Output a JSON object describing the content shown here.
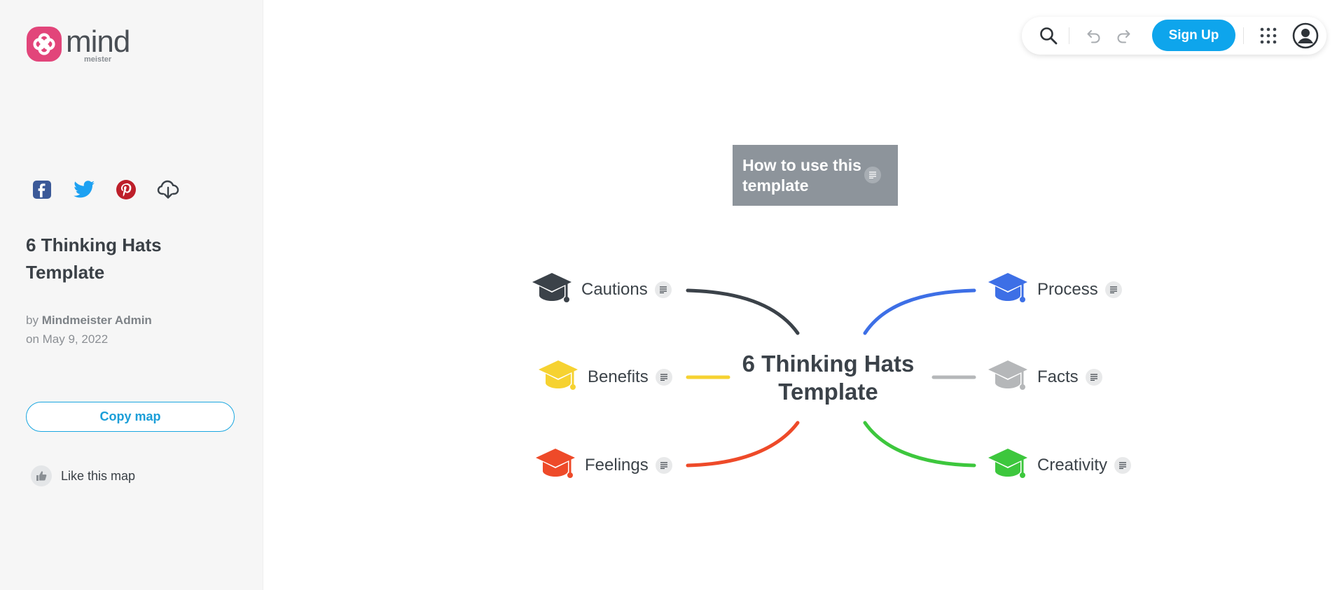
{
  "brand": {
    "name": "mind",
    "sub": "meister",
    "color": "#e2457a"
  },
  "share": {
    "icons": [
      "facebook-icon",
      "twitter-icon",
      "pinterest-icon",
      "cloud-download-icon"
    ]
  },
  "map_info": {
    "title": "6 Thinking Hats Template",
    "by_prefix": "by",
    "author": "Mindmeister Admin",
    "date": "on May 9, 2022"
  },
  "actions": {
    "copy_label": "Copy map",
    "like_label": "Like this map"
  },
  "toolbar": {
    "signup_label": "Sign Up",
    "accent": "#0ea5ec"
  },
  "map": {
    "usage_node": "How to use this template",
    "center": "6 Thinking Hats Template",
    "topics": [
      {
        "label": "Cautions",
        "color": "#3b4249"
      },
      {
        "label": "Benefits",
        "color": "#f6d231"
      },
      {
        "label": "Feelings",
        "color": "#ee4a29"
      },
      {
        "label": "Process",
        "color": "#3d6fe6"
      },
      {
        "label": "Facts",
        "color": "#b5b7b9"
      },
      {
        "label": "Creativity",
        "color": "#3dc73d"
      }
    ]
  }
}
